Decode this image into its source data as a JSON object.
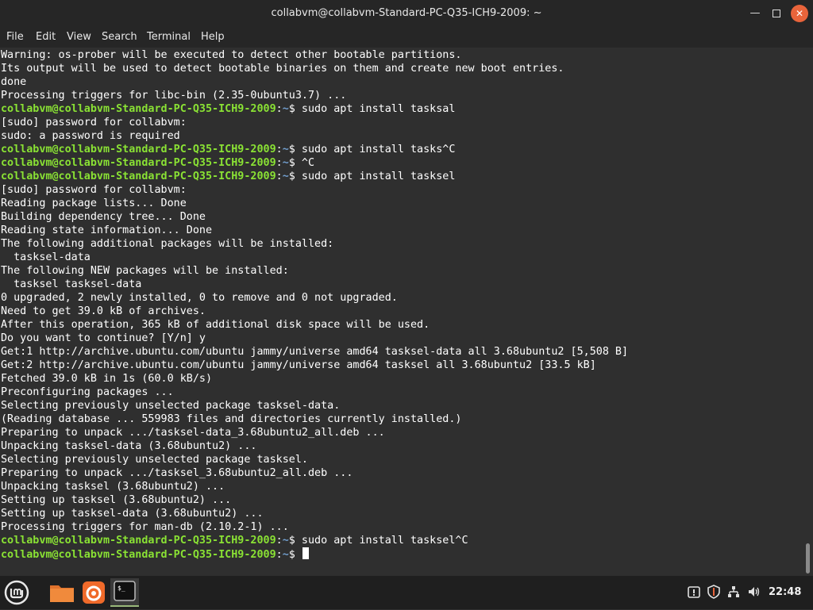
{
  "window": {
    "title": "collabvm@collabvm-Standard-PC-Q35-ICH9-2009: ~",
    "min_icon": "minimize-icon",
    "max_icon": "maximize-icon",
    "close_icon": "close-icon"
  },
  "menu": [
    "File",
    "Edit",
    "View",
    "Search",
    "Terminal",
    "Help"
  ],
  "terminal": {
    "prompt_user": "collabvm@collabvm-Standard-PC-Q35-ICH9-2009",
    "prompt_sep": ":",
    "prompt_path": "~",
    "prompt_end": "$ ",
    "lines": [
      {
        "type": "out",
        "text": "Warning: os-prober will be executed to detect other bootable partitions."
      },
      {
        "type": "out",
        "text": "Its output will be used to detect bootable binaries on them and create new boot entries."
      },
      {
        "type": "out",
        "text": "done"
      },
      {
        "type": "out",
        "text": "Processing triggers for libc-bin (2.35-0ubuntu3.7) ..."
      },
      {
        "type": "cmd",
        "text": "sudo apt install tasksal"
      },
      {
        "type": "out",
        "text": "[sudo] password for collabvm:"
      },
      {
        "type": "out",
        "text": "sudo: a password is required"
      },
      {
        "type": "cmd",
        "text": "sudo apt install tasks^C"
      },
      {
        "type": "cmd",
        "text": "^C"
      },
      {
        "type": "cmd",
        "text": "sudo apt install tasksel"
      },
      {
        "type": "out",
        "text": "[sudo] password for collabvm:"
      },
      {
        "type": "out",
        "text": "Reading package lists... Done"
      },
      {
        "type": "out",
        "text": "Building dependency tree... Done"
      },
      {
        "type": "out",
        "text": "Reading state information... Done"
      },
      {
        "type": "out",
        "text": "The following additional packages will be installed:"
      },
      {
        "type": "out",
        "text": "  tasksel-data"
      },
      {
        "type": "out",
        "text": "The following NEW packages will be installed:"
      },
      {
        "type": "out",
        "text": "  tasksel tasksel-data"
      },
      {
        "type": "out",
        "text": "0 upgraded, 2 newly installed, 0 to remove and 0 not upgraded."
      },
      {
        "type": "out",
        "text": "Need to get 39.0 kB of archives."
      },
      {
        "type": "out",
        "text": "After this operation, 365 kB of additional disk space will be used."
      },
      {
        "type": "out",
        "text": "Do you want to continue? [Y/n] y"
      },
      {
        "type": "out",
        "text": "Get:1 http://archive.ubuntu.com/ubuntu jammy/universe amd64 tasksel-data all 3.68ubuntu2 [5,508 B]"
      },
      {
        "type": "out",
        "text": "Get:2 http://archive.ubuntu.com/ubuntu jammy/universe amd64 tasksel all 3.68ubuntu2 [33.5 kB]"
      },
      {
        "type": "out",
        "text": "Fetched 39.0 kB in 1s (60.0 kB/s)"
      },
      {
        "type": "out",
        "text": "Preconfiguring packages ..."
      },
      {
        "type": "out",
        "text": "Selecting previously unselected package tasksel-data."
      },
      {
        "type": "out",
        "text": "(Reading database ... 559983 files and directories currently installed.)"
      },
      {
        "type": "out",
        "text": "Preparing to unpack .../tasksel-data_3.68ubuntu2_all.deb ..."
      },
      {
        "type": "out",
        "text": "Unpacking tasksel-data (3.68ubuntu2) ..."
      },
      {
        "type": "out",
        "text": "Selecting previously unselected package tasksel."
      },
      {
        "type": "out",
        "text": "Preparing to unpack .../tasksel_3.68ubuntu2_all.deb ..."
      },
      {
        "type": "out",
        "text": "Unpacking tasksel (3.68ubuntu2) ..."
      },
      {
        "type": "out",
        "text": "Setting up tasksel (3.68ubuntu2) ..."
      },
      {
        "type": "out",
        "text": "Setting up tasksel-data (3.68ubuntu2) ..."
      },
      {
        "type": "out",
        "text": "Processing triggers for man-db (2.10.2-1) ..."
      },
      {
        "type": "cmd",
        "text": "sudo apt install tasksel^C"
      },
      {
        "type": "cmd",
        "text": "",
        "cursor": true
      }
    ]
  },
  "taskbar": {
    "items": [
      {
        "name": "mint-menu-icon"
      },
      {
        "name": "files-folder-icon"
      },
      {
        "name": "firefox-icon"
      },
      {
        "name": "terminal-icon",
        "active": true
      }
    ],
    "tray": [
      "update-manager-icon",
      "shield-icon",
      "network-icon",
      "volume-icon"
    ],
    "clock": "22:48"
  },
  "colors": {
    "background": "#2f2f2f",
    "prompt_user": "#8ae234",
    "prompt_path": "#729fcf",
    "close_button": "#e9643b",
    "folder": "#f08a3c"
  }
}
